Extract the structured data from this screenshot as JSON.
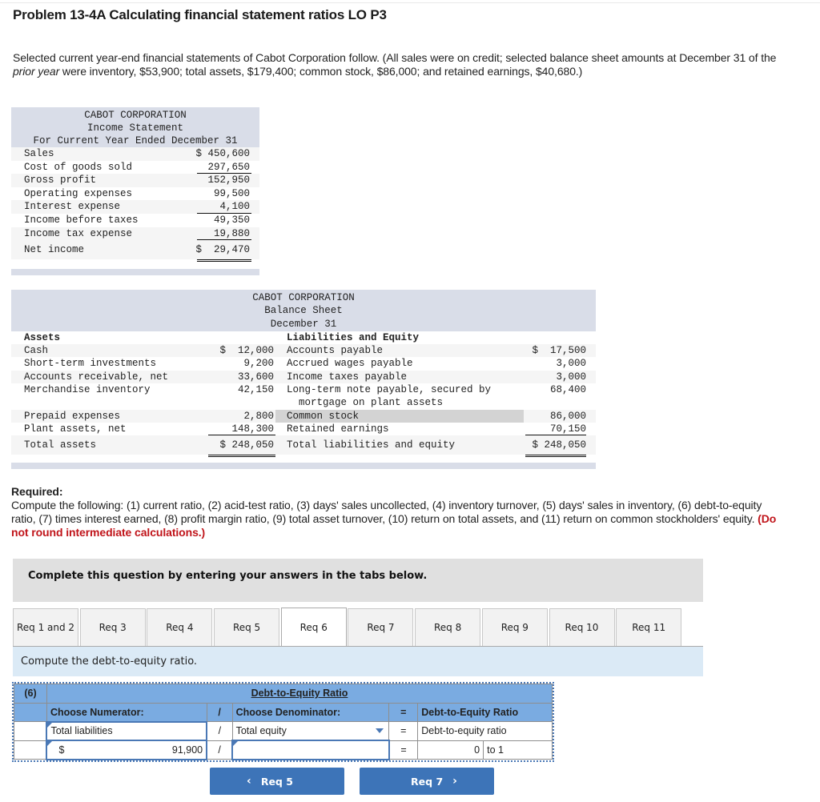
{
  "problem": {
    "title": "Problem 13-4A Calculating financial statement ratios LO P3",
    "intro_before_em": "Selected current year-end financial statements of Cabot Corporation follow. (All sales were on credit; selected balance sheet amounts at December 31 of the ",
    "intro_em": "prior year",
    "intro_after_em": " were inventory, $53,900; total assets, $179,400; common stock, $86,000; and retained earnings, $40,680.)"
  },
  "income_statement": {
    "company": "CABOT CORPORATION",
    "name": "Income Statement",
    "period": "For Current Year Ended December 31",
    "rows": [
      {
        "label": "Sales",
        "value": "$ 450,600"
      },
      {
        "label": "Cost of goods sold",
        "value": "297,650"
      },
      {
        "label": "Gross profit",
        "value": "152,950"
      },
      {
        "label": "Operating expenses",
        "value": "99,500"
      },
      {
        "label": "Interest expense",
        "value": "4,100"
      },
      {
        "label": "Income before taxes",
        "value": "49,350"
      },
      {
        "label": "Income tax expense",
        "value": "19,880"
      },
      {
        "label": "Net income",
        "value": "$  29,470"
      }
    ]
  },
  "balance_sheet": {
    "company": "CABOT CORPORATION",
    "name": "Balance Sheet",
    "date": "December 31",
    "assets_heading": "Assets",
    "liabilities_heading": "Liabilities and Equity",
    "assets": [
      {
        "label": "Cash",
        "value": "$  12,000"
      },
      {
        "label": "Short-term investments",
        "value": "9,200"
      },
      {
        "label": "Accounts receivable, net",
        "value": "33,600"
      },
      {
        "label": "Merchandise inventory",
        "value": "42,150"
      },
      {
        "label": "Prepaid expenses",
        "value": "2,800"
      },
      {
        "label": "Plant assets, net",
        "value": "148,300"
      }
    ],
    "total_assets_label": "Total assets",
    "total_assets_value": "$ 248,050",
    "liabilities": [
      {
        "label": "Accounts payable",
        "value": "$  17,500"
      },
      {
        "label": "Accrued wages payable",
        "value": "3,000"
      },
      {
        "label": "Income taxes payable",
        "value": "3,000"
      },
      {
        "label": "Long-term note payable, secured by",
        "value": "68,400"
      },
      {
        "label": "  mortgage on plant assets",
        "value": ""
      },
      {
        "label": "Common stock",
        "value": "86,000"
      },
      {
        "label": "Retained earnings",
        "value": "70,150"
      }
    ],
    "total_liabilities_label": "Total liabilities and equity",
    "total_liabilities_value": "$ 248,050"
  },
  "required": {
    "heading": "Required:",
    "text": "Compute the following: (1) current ratio, (2) acid-test ratio, (3) days' sales uncollected, (4) inventory turnover, (5) days' sales in inventory, (6) debt-to-equity ratio, (7) times interest earned, (8) profit margin ratio, (9) total asset turnover, (10) return on total assets, and (11) return on common stockholders' equity. ",
    "note": "(Do not round intermediate calculations.)"
  },
  "banner": "Complete this question by entering your answers in the tabs below.",
  "tabs": [
    {
      "label": "Req 1 and 2",
      "active": false
    },
    {
      "label": "Req 3",
      "active": false
    },
    {
      "label": "Req 4",
      "active": false
    },
    {
      "label": "Req 5",
      "active": false
    },
    {
      "label": "Req 6",
      "active": true
    },
    {
      "label": "Req 7",
      "active": false
    },
    {
      "label": "Req 8",
      "active": false
    },
    {
      "label": "Req 9",
      "active": false
    },
    {
      "label": "Req 10",
      "active": false
    },
    {
      "label": "Req 11",
      "active": false
    }
  ],
  "instruction": "Compute the debt-to-equity ratio.",
  "calc": {
    "number": "(6)",
    "title": "Debt-to-Equity Ratio",
    "numerator_header": "Choose Numerator:",
    "divide": "/",
    "denominator_header": "Choose Denominator:",
    "equals": "=",
    "result_header": "Debt-to-Equity Ratio",
    "numerator_label": "Total liabilities",
    "denominator_label": "Total equity",
    "result_label": "Debt-to-equity ratio",
    "currency": "$",
    "numerator_value": "91,900",
    "denominator_value": "",
    "result_value": "0",
    "result_suffix": "to 1"
  },
  "nav": {
    "prev_label": "Req 5",
    "next_label": "Req 7"
  }
}
